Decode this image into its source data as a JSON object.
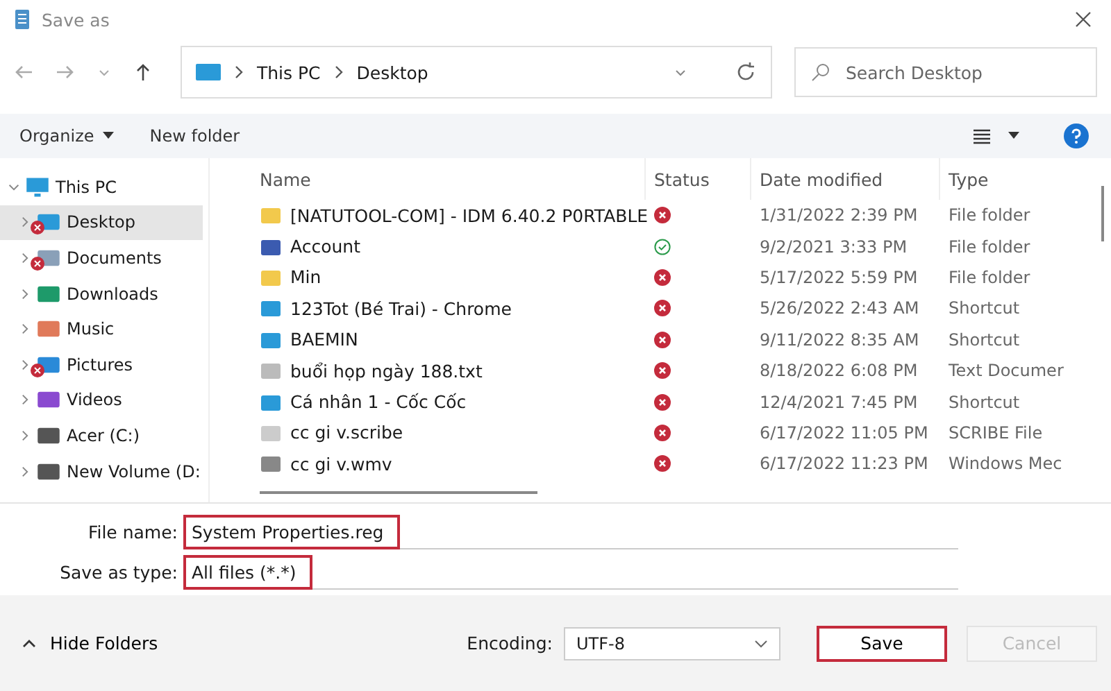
{
  "window": {
    "title": "Save as"
  },
  "address": {
    "path": [
      "This PC",
      "Desktop"
    ]
  },
  "search": {
    "placeholder": "Search Desktop"
  },
  "toolbar": {
    "organize": "Organize",
    "new_folder": "New folder"
  },
  "sidebar": {
    "items": [
      {
        "label": "This PC",
        "kind": "pc",
        "expanded": true,
        "selected": false,
        "sync_error": false,
        "children": [
          {
            "label": "Desktop",
            "kind": "desktop",
            "expanded": false,
            "selected": true,
            "sync_error": true
          },
          {
            "label": "Documents",
            "kind": "documents",
            "expanded": false,
            "selected": false,
            "sync_error": true
          },
          {
            "label": "Downloads",
            "kind": "downloads",
            "expanded": false,
            "selected": false,
            "sync_error": false
          },
          {
            "label": "Music",
            "kind": "music",
            "expanded": false,
            "selected": false,
            "sync_error": false
          },
          {
            "label": "Pictures",
            "kind": "pictures",
            "expanded": false,
            "selected": false,
            "sync_error": true
          },
          {
            "label": "Videos",
            "kind": "videos",
            "expanded": false,
            "selected": false,
            "sync_error": false
          },
          {
            "label": "Acer (C:)",
            "kind": "drive",
            "expanded": false,
            "selected": false,
            "sync_error": false
          },
          {
            "label": "New Volume (D:",
            "kind": "drive",
            "expanded": false,
            "selected": false,
            "sync_error": false
          }
        ]
      }
    ]
  },
  "table": {
    "columns": [
      "Name",
      "Status",
      "Date modified",
      "Type"
    ],
    "rows": [
      {
        "name": "[NATUTOOL-COM] - IDM 6.40.2 P0RTABLE",
        "kind": "folder",
        "sync_error": true,
        "date": "1/31/2022 2:39 PM",
        "type": "File folder"
      },
      {
        "name": "Account",
        "kind": "app",
        "sync_error": false,
        "date": "9/2/2021 3:33 PM",
        "type": "File folder"
      },
      {
        "name": "Min",
        "kind": "folder",
        "sync_error": true,
        "date": "5/17/2022 5:59 PM",
        "type": "File folder"
      },
      {
        "name": "123Tot (Bé Trai) - Chrome",
        "kind": "shortcut",
        "sync_error": true,
        "date": "5/26/2022 2:43 AM",
        "type": "Shortcut"
      },
      {
        "name": "BAEMIN",
        "kind": "shortcut",
        "sync_error": true,
        "date": "9/11/2022 8:35 AM",
        "type": "Shortcut"
      },
      {
        "name": "buổi họp ngày 188.txt",
        "kind": "text",
        "sync_error": true,
        "date": "8/18/2022 6:08 PM",
        "type": "Text Documer"
      },
      {
        "name": "Cá nhân 1 - Cốc Cốc",
        "kind": "shortcut",
        "sync_error": true,
        "date": "12/4/2021 7:45 PM",
        "type": "Shortcut"
      },
      {
        "name": "cc gi v.scribe",
        "kind": "file",
        "sync_error": true,
        "date": "6/17/2022 11:05 PM",
        "type": "SCRIBE File"
      },
      {
        "name": "cc gi v.wmv",
        "kind": "video",
        "sync_error": true,
        "date": "6/17/2022 11:23 PM",
        "type": "Windows Mec"
      }
    ]
  },
  "fields": [
    {
      "label": "File name:",
      "value": "System Properties.reg",
      "highlighted": true
    },
    {
      "label": "Save as type:",
      "value": "All files  (*.*)",
      "highlighted": true
    }
  ],
  "footer": {
    "hide_folders": "Hide Folders",
    "encoding_label": "Encoding:",
    "encoding": "UTF-8",
    "buttons": [
      {
        "label": "Save",
        "highlighted": true,
        "disabled": false
      },
      {
        "label": "Cancel",
        "highlighted": false,
        "disabled": true
      }
    ]
  }
}
